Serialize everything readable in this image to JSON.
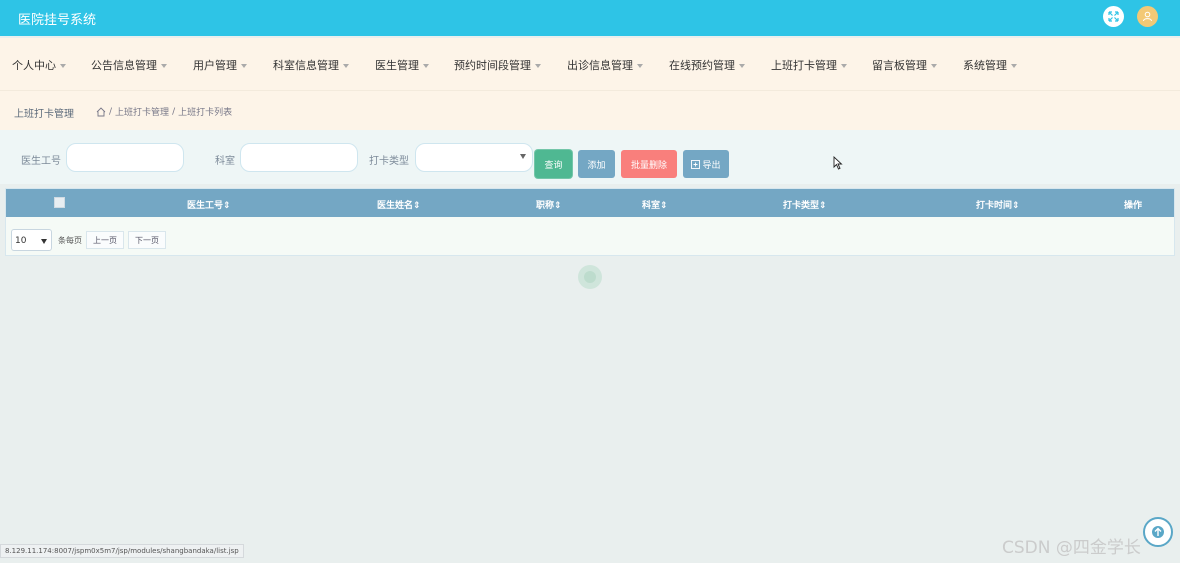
{
  "app": {
    "title": "医院挂号系统"
  },
  "header_icons": [
    "fullscreen-icon",
    "user-avatar-icon"
  ],
  "nav": {
    "items": [
      {
        "label": "个人中心"
      },
      {
        "label": "公告信息管理"
      },
      {
        "label": "用户管理"
      },
      {
        "label": "科室信息管理"
      },
      {
        "label": "医生管理"
      },
      {
        "label": "预约时间段管理"
      },
      {
        "label": "出诊信息管理"
      },
      {
        "label": "在线预约管理"
      },
      {
        "label": "上班打卡管理"
      },
      {
        "label": "留言板管理"
      },
      {
        "label": "系统管理"
      }
    ]
  },
  "breadcrumb": {
    "title": "上班打卡管理",
    "sep": "/",
    "path1": "上班打卡管理",
    "path2": "上班打卡列表"
  },
  "search": {
    "doctor_id_label": "医生工号",
    "dept_label": "科室",
    "clock_type_label": "打卡类型",
    "search_button": "查询",
    "add_button": "添加",
    "batch_delete_button": "批量删除",
    "export_button": "导出"
  },
  "table": {
    "columns": [
      "医生工号",
      "医生姓名",
      "职称",
      "科室",
      "打卡类型",
      "打卡时间",
      "操作"
    ],
    "rows": []
  },
  "pager": {
    "page_size": "10",
    "per_page_label": "条每页",
    "prev": "上一页",
    "next": "下一页"
  },
  "statusbar": {
    "url": "8.129.11.174:8007/jspm0x5m7/jsp/modules/shangbandaka/list.jsp"
  },
  "watermark": "CSDN @四金学长",
  "colors": {
    "topbar": "#2ec4e6",
    "nav_bg": "#fdf4e8",
    "table_header": "#74a7c4",
    "danger": "#f97f7c",
    "success": "#4fb892"
  }
}
